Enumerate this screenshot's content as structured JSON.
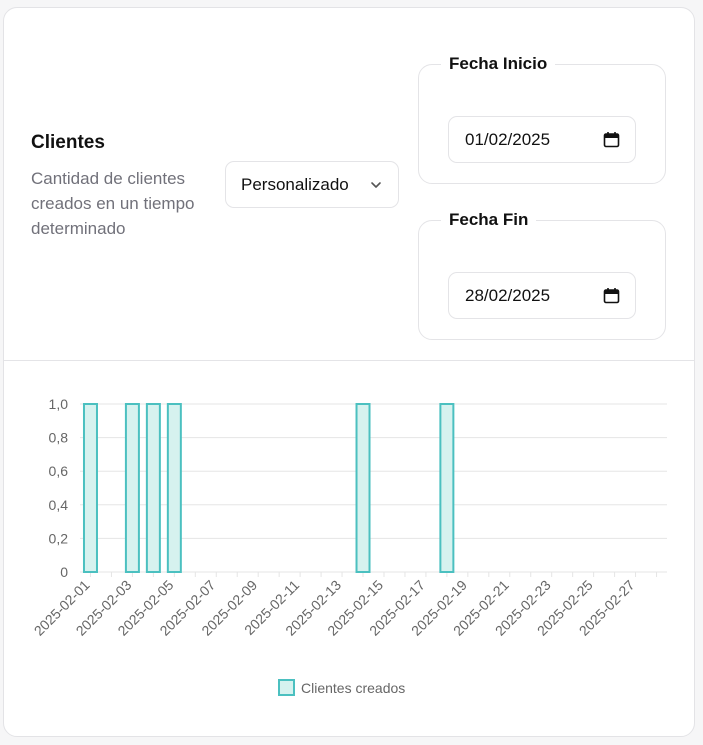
{
  "header": {
    "title": "Clientes",
    "description": "Cantidad de clientes creados en un tiempo determinado",
    "range_select": {
      "value": "Personalizado"
    },
    "start_date": {
      "label": "Fecha Inicio",
      "value": "01/02/2025"
    },
    "end_date": {
      "label": "Fecha Fin",
      "value": "28/02/2025"
    }
  },
  "colors": {
    "bar_fill": "#d6f2ef",
    "bar_stroke": "#4bc0c0",
    "grid": "#e5e5e5"
  },
  "chart_data": {
    "type": "bar",
    "categories": [
      "2025-02-01",
      "2025-02-02",
      "2025-02-03",
      "2025-02-04",
      "2025-02-05",
      "2025-02-06",
      "2025-02-07",
      "2025-02-08",
      "2025-02-09",
      "2025-02-10",
      "2025-02-11",
      "2025-02-12",
      "2025-02-13",
      "2025-02-14",
      "2025-02-15",
      "2025-02-16",
      "2025-02-17",
      "2025-02-18",
      "2025-02-19",
      "2025-02-20",
      "2025-02-21",
      "2025-02-22",
      "2025-02-23",
      "2025-02-24",
      "2025-02-25",
      "2025-02-26",
      "2025-02-27",
      "2025-02-28"
    ],
    "tick_labels": [
      "2025-02-01",
      "2025-02-03",
      "2025-02-05",
      "2025-02-07",
      "2025-02-09",
      "2025-02-11",
      "2025-02-13",
      "2025-02-15",
      "2025-02-17",
      "2025-02-19",
      "2025-02-21",
      "2025-02-23",
      "2025-02-25",
      "2025-02-27"
    ],
    "series": [
      {
        "name": "Clientes creados",
        "values": [
          1,
          0,
          1,
          1,
          1,
          0,
          0,
          0,
          0,
          0,
          0,
          0,
          0,
          1,
          0,
          0,
          0,
          1,
          0,
          0,
          0,
          0,
          0,
          0,
          0,
          0,
          0,
          0
        ]
      }
    ],
    "ylim": [
      0,
      1
    ],
    "y_ticks": [
      "0",
      "0,2",
      "0,4",
      "0,6",
      "0,8",
      "1,0"
    ],
    "legend": "bottom",
    "grid": true
  }
}
